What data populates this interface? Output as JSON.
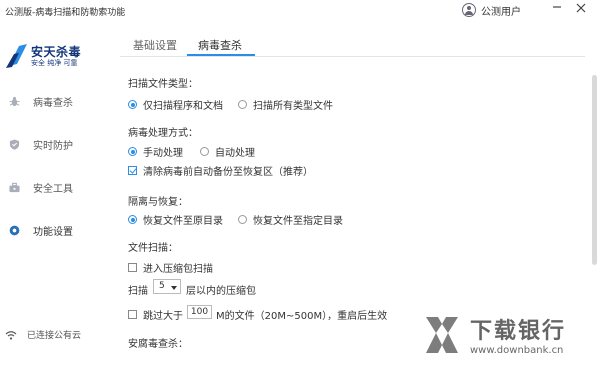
{
  "window": {
    "title": "公测版-病毒扫描和防勒索功能",
    "user_name": "公测用户",
    "minimize_icon": "minimize-icon",
    "close_icon": "close-icon"
  },
  "brand": {
    "name": "安天杀毒",
    "slogan": "安全 纯净 可靠",
    "colors": {
      "primary": "#12357a",
      "accent": "#2b8de3"
    }
  },
  "sidebar": {
    "items": [
      {
        "label": "病毒查杀",
        "icon": "bug-icon",
        "active": false
      },
      {
        "label": "实时防护",
        "icon": "shield-icon",
        "active": false
      },
      {
        "label": "安全工具",
        "icon": "toolbox-icon",
        "active": false
      },
      {
        "label": "功能设置",
        "icon": "gear-icon",
        "active": true
      }
    ],
    "status": "已连接公有云",
    "status_icon": "wifi-icon"
  },
  "tabs": [
    {
      "label": "基础设置",
      "active": false
    },
    {
      "label": "病毒查杀",
      "active": true
    }
  ],
  "settings": {
    "scan_types": {
      "title": "扫描文件类型：",
      "options": [
        "仅扫描程序和文档",
        "扫描所有类型文件"
      ],
      "selected": 0
    },
    "virus_handling": {
      "title": "病毒处理方式：",
      "options": [
        "手动处理",
        "自动处理"
      ],
      "selected": 0,
      "backup_label": "清除病毒前自动备份至恢复区（推荐）",
      "backup_checked": true
    },
    "quarantine": {
      "title": "隔离与恢复：",
      "options": [
        "恢复文件至原目录",
        "恢复文件至指定目录"
      ],
      "selected": 0
    },
    "file_scan": {
      "title": "文件扫描：",
      "archive_label": "进入压缩包扫描",
      "archive_checked": false,
      "scan_prefix": "扫描",
      "depth_value": "5",
      "depth_suffix": "层以内的压缩包",
      "skip_prefix": "跳过大于",
      "skip_value": "100",
      "skip_suffix": "M的文件（20M~500M），重启后生效",
      "skip_checked": false
    },
    "next_section_title": "安腐毒查杀："
  },
  "watermark": {
    "name": "下载银行",
    "url": "www.downbank.cn"
  }
}
